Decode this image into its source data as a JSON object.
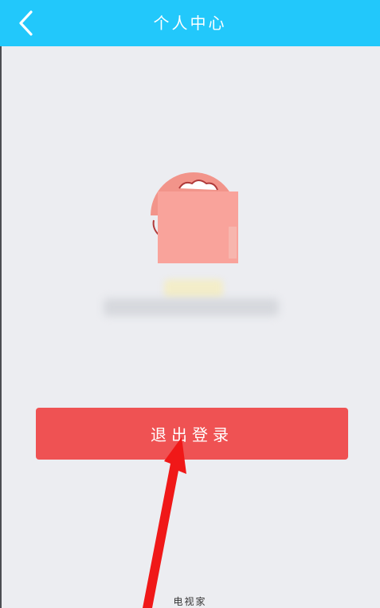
{
  "header": {
    "title": "个人中心",
    "back_icon": "chevron-left-icon"
  },
  "profile": {
    "avatar_icon": "cartoon-avatar-icon"
  },
  "actions": {
    "logout_label": "退出登录"
  },
  "annotation": {
    "arrow_icon": "red-arrow-icon"
  },
  "footer": {
    "watermark": "电视家"
  },
  "colors": {
    "header": "#22c8fb",
    "background": "#ecedf1",
    "logout_button": "#ef5253",
    "arrow": "#f01818"
  }
}
